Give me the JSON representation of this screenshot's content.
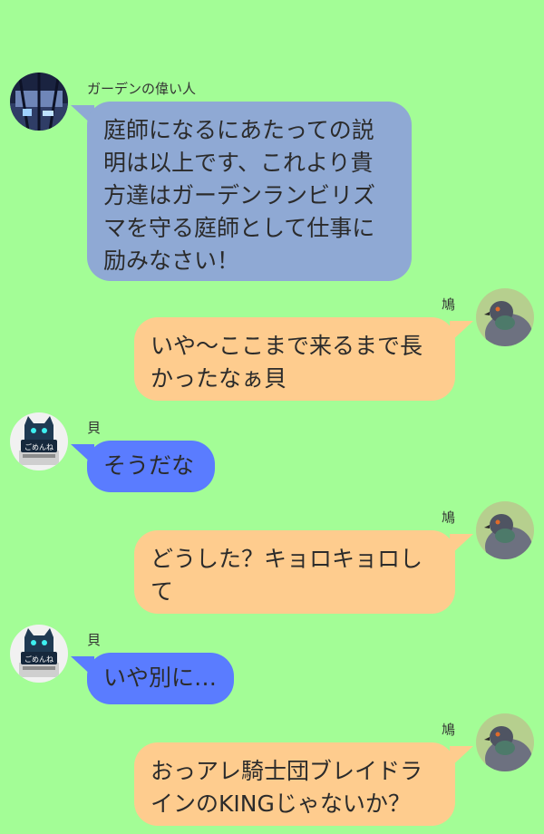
{
  "chat": {
    "colors": {
      "background": "#a3fd96",
      "admin_bubble": "#8fa9d4",
      "right_bubble": "#fecc8e",
      "left_bubble": "#5a7cff"
    },
    "messages": [
      {
        "sender": "ガーデンの偉い人",
        "avatar": "city-window-icon",
        "side": "left",
        "text": "庭師になるにあたっての説\n明は以上です、これより貴\n方達はガーデンランビリズ\nマを守る庭師として仕事に\n励みなさい！"
      },
      {
        "sender": "鳩",
        "avatar": "pigeon-icon",
        "side": "right",
        "text": "いや〜ここまで来るまで長\nかったなぁ貝"
      },
      {
        "sender": "貝",
        "avatar": "robot-cat-icon",
        "avatar_label": "ごめんね",
        "side": "left",
        "text": "そうだな"
      },
      {
        "sender": "鳩",
        "avatar": "pigeon-icon",
        "side": "right",
        "text": "どうした？キョロキョロし\nて"
      },
      {
        "sender": "貝",
        "avatar": "robot-cat-icon",
        "avatar_label": "ごめんね",
        "side": "left",
        "text": "いや別に…"
      },
      {
        "sender": "鳩",
        "avatar": "pigeon-icon",
        "side": "right",
        "text": "おっアレ騎士団ブレイドラ\nインのKINGじゃないか？"
      }
    ]
  }
}
